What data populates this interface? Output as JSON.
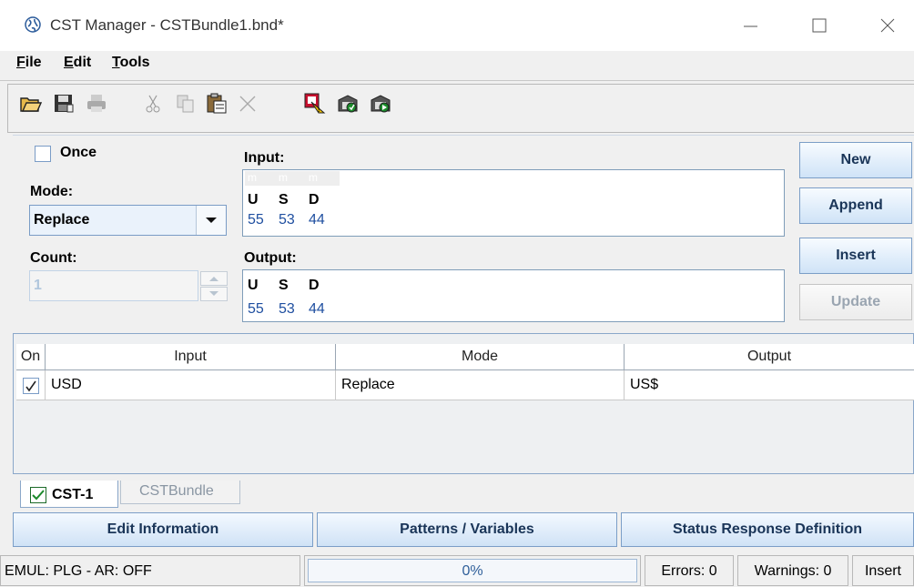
{
  "window": {
    "title": "CST Manager - CSTBundle1.bnd*",
    "controls": [
      "minimize-icon",
      "maximize-icon",
      "close-icon"
    ]
  },
  "menu": {
    "items": [
      {
        "label": "ile",
        "mnemonic": "F"
      },
      {
        "label": "dit",
        "mnemonic": "E"
      },
      {
        "label": "ools",
        "mnemonic": "T"
      }
    ]
  },
  "toolbar": {
    "icons": [
      "open-icon",
      "save-icon",
      "print-icon",
      "cut-icon",
      "copy-icon",
      "paste-icon",
      "delete-icon",
      "convert-icon",
      "export-icon",
      "import-icon"
    ]
  },
  "editor": {
    "once_label": "Once",
    "once_checked": false,
    "mode_label": "Mode:",
    "mode_value": "Replace",
    "count_label": "Count:",
    "count_value": "1",
    "input_label": "Input:",
    "input_cursor_marks": [
      "m",
      "m",
      "m"
    ],
    "input_chars": [
      "U",
      "S",
      "D"
    ],
    "input_hex": [
      "55",
      "53",
      "44"
    ],
    "output_label": "Output:",
    "output_chars": [
      "U",
      "S",
      "D"
    ],
    "output_hex": [
      "55",
      "53",
      "44"
    ]
  },
  "actions": {
    "new": "New",
    "append": "Append",
    "insert": "Insert",
    "update": "Update"
  },
  "table": {
    "columns": [
      "On",
      "Input",
      "Mode",
      "Output"
    ],
    "rows": [
      {
        "on": true,
        "input": "USD",
        "mode": "Replace",
        "output": "US$"
      }
    ]
  },
  "tabs": [
    {
      "label": "CST-1",
      "active": true,
      "checked": true
    },
    {
      "label": "CSTBundle",
      "active": false
    }
  ],
  "bottom_buttons": {
    "edit_info": "Edit Information",
    "patterns": "Patterns / Variables",
    "status_resp": "Status Response Definition"
  },
  "status": {
    "emul": "EMUL: PLG - AR: OFF",
    "progress": "0%",
    "progress_value": 0,
    "errors": "Errors: 0",
    "warnings": "Warnings: 0",
    "mode": "Insert"
  },
  "colors": {
    "accent_blue": "#1f4fa0",
    "check_green": "#1b8a2a"
  }
}
